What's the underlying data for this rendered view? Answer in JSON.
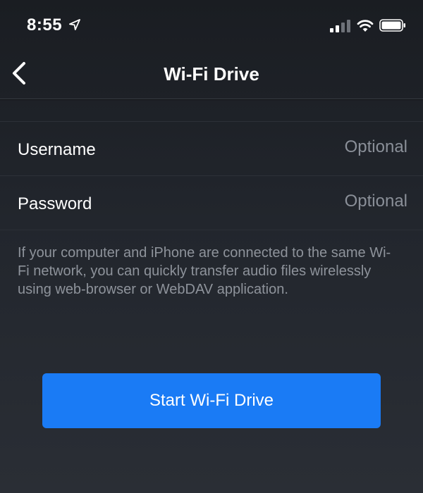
{
  "status_bar": {
    "time": "8:55",
    "icons": [
      "location-arrow-icon",
      "cellular-signal-icon",
      "wifi-icon",
      "battery-icon"
    ]
  },
  "nav": {
    "back_icon": "chevron-left-icon",
    "title": "Wi-Fi Drive"
  },
  "form": {
    "username": {
      "label": "Username",
      "placeholder": "Optional",
      "value": ""
    },
    "password": {
      "label": "Password",
      "placeholder": "Optional",
      "value": ""
    }
  },
  "help_text": "If your computer and iPhone are connected to the same Wi-Fi network, you can quickly transfer audio files wirelessly using web-browser or WebDAV application.",
  "start_button": {
    "label": "Start Wi-Fi Drive"
  },
  "colors": {
    "accent": "#1a7bf5",
    "background": "#1f2228",
    "placeholder": "#8a8f98",
    "secondary_text": "#8e939b"
  }
}
